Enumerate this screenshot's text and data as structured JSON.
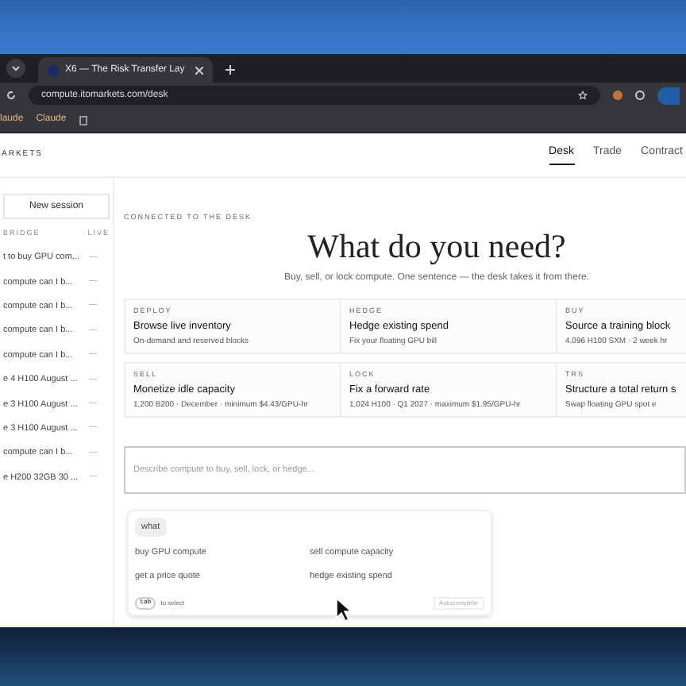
{
  "browser": {
    "tab_title": "X6 — The Risk Transfer Lay",
    "url": "compute.itomarkets.com/desk",
    "bookmarks": [
      "laude",
      "Claude"
    ]
  },
  "header": {
    "logo": "ARKETS",
    "nav": [
      {
        "label": "Desk",
        "selected": true
      },
      {
        "label": "Trade",
        "selected": false
      },
      {
        "label": "Contract",
        "selected": false
      }
    ]
  },
  "sidebar": {
    "new_session": "New session",
    "columns": [
      "BRIDGE",
      "LIVE"
    ],
    "items": [
      {
        "title": "t to buy GPU com...",
        "status": "—"
      },
      {
        "title": "compute can I b...",
        "status": "—"
      },
      {
        "title": "compute can I b...",
        "status": "—"
      },
      {
        "title": "compute can I b...",
        "status": "—"
      },
      {
        "title": "compute can I b...",
        "status": "—"
      },
      {
        "title": "e 4 H100 August ...",
        "status": "—"
      },
      {
        "title": "e 3 H100 August ...",
        "status": "—"
      },
      {
        "title": "e 3 H100 August ...",
        "status": "—"
      },
      {
        "title": "compute can I b...",
        "status": "—"
      },
      {
        "title": "e H200 32GB 30 ...",
        "status": "—"
      }
    ]
  },
  "main": {
    "eyebrow": "CONNECTED TO THE DESK",
    "title": "What do you need?",
    "subtitle": "Buy, sell, or lock compute. One sentence — the desk takes it from there.",
    "cards": [
      {
        "tag": "DEPLOY",
        "title": "Browse live inventory",
        "detail": "On-demand and reserved blocks"
      },
      {
        "tag": "HEDGE",
        "title": "Hedge existing spend",
        "detail": "Fix your floating GPU bill"
      },
      {
        "tag": "BUY",
        "title": "Source a training block",
        "detail": "4,096 H100 SXM · 2 week hr"
      },
      {
        "tag": "SELL",
        "title": "Monetize idle capacity",
        "detail": "1,200 B200 · December · minimum $4.43/GPU-hr"
      },
      {
        "tag": "LOCK",
        "title": "Fix a forward rate",
        "detail": "1,024 H100 · Q1 2027 · maximum $1.95/GPU-hr"
      },
      {
        "tag": "TRS",
        "title": "Structure a total return s",
        "detail": "Swap floating GPU spot e"
      }
    ],
    "input": {
      "placeholder": "Describe compute to buy, sell, lock, or hedge..."
    },
    "suggest": {
      "chip": "what",
      "options": [
        "buy GPU compute",
        "sell compute capacity",
        "get a price quote",
        "hedge existing spend"
      ],
      "key": "tab",
      "key_hint": "to select",
      "right_hint": "Autocomplete"
    }
  }
}
